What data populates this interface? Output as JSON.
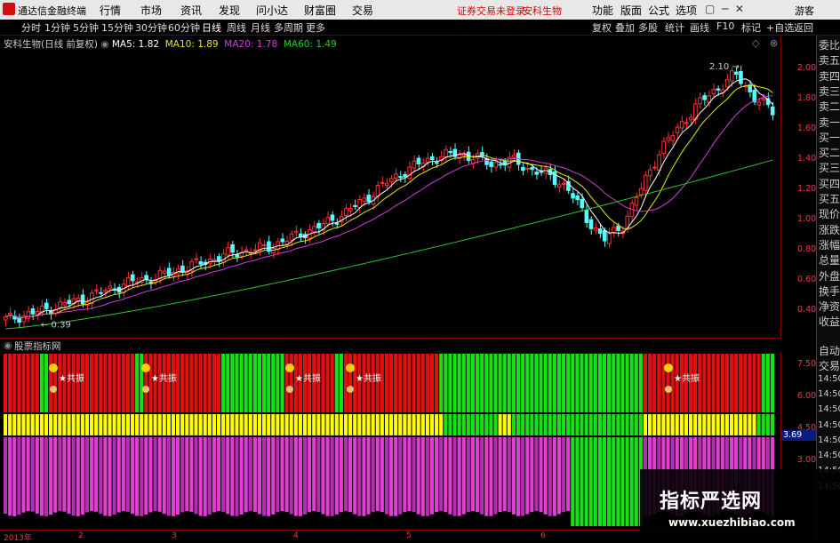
{
  "app": {
    "name": "通达信金融终端"
  },
  "menu": [
    "行情",
    "市场",
    "资讯",
    "发现",
    "问小达",
    "财富圈",
    "交易"
  ],
  "alert_text": "证券交易未登录",
  "top_stock": "安科生物",
  "right_menu": [
    "功能",
    "版面",
    "公式",
    "选项"
  ],
  "guest": "游客",
  "toolbar": {
    "periods": [
      "分时",
      "1分钟",
      "5分钟",
      "15分钟",
      "30分钟",
      "60分钟",
      "日线",
      "周线",
      "月线",
      "多周期",
      "更多"
    ],
    "active": "日线",
    "right_buttons": [
      "复权",
      "叠加",
      "多股",
      "统计",
      "画线",
      "F10",
      "标记",
      "+自选",
      "返回"
    ]
  },
  "title": {
    "stock": "安科生物(日线 前复权)",
    "ma5": "MA5: 1.82",
    "ma10": "MA10: 1.89",
    "ma20": "MA20: 1.78",
    "ma60": "MA60: 1.49",
    "colors": {
      "ma5": "#ffffff",
      "ma10": "#e8e800",
      "ma20": "#d040d0",
      "ma60": "#30c030"
    }
  },
  "price_axis": [
    "2.00",
    "1.80",
    "1.60",
    "1.40",
    "1.20",
    "1.00",
    "0.80",
    "0.60",
    "0.40"
  ],
  "annotations": {
    "high": "2.10",
    "low": "0.39"
  },
  "indicator": {
    "title": "股票指标网",
    "signal_label": "共振",
    "axis": [
      "7.50",
      "6.00",
      "4.50",
      "3.00"
    ],
    "value_box": "3.69"
  },
  "sidebar": {
    "top": [
      "委比",
      "卖五",
      "卖四",
      "卖三",
      "卖二",
      "卖一",
      "买一",
      "买二",
      "买三",
      "买四",
      "买五",
      "现价",
      "涨跌",
      "涨幅",
      "总量",
      "外盘",
      "换手",
      "净资",
      "收益"
    ],
    "bottom": [
      "自动",
      "交易",
      "14:50",
      "14:50",
      "14:50",
      "14:50",
      "14:50",
      "14:50",
      "14:50",
      "14:50"
    ]
  },
  "date_axis": [
    "2013年",
    "2",
    "3",
    "4",
    "5",
    "6"
  ],
  "watermark": {
    "title": "指标严选网",
    "url": "www.xuezhibiao.com"
  },
  "chart_data": {
    "type": "candlestick",
    "ylim": [
      0.3,
      2.2
    ],
    "ma_series": [
      "MA5",
      "MA10",
      "MA20",
      "MA60"
    ],
    "approx_close": [
      0.42,
      0.45,
      0.48,
      0.52,
      0.55,
      0.6,
      0.64,
      0.68,
      0.7,
      0.74,
      0.78,
      0.82,
      0.86,
      0.88,
      0.9,
      0.95,
      1.0,
      1.05,
      1.12,
      1.2,
      1.3,
      1.38,
      1.45,
      1.5,
      1.52,
      1.5,
      1.45,
      1.48,
      1.42,
      1.38,
      1.3,
      1.1,
      0.95,
      1.05,
      1.3,
      1.55,
      1.7,
      1.85,
      1.95,
      2.05,
      1.9,
      1.8
    ],
    "high": 2.1,
    "low": 0.39
  }
}
